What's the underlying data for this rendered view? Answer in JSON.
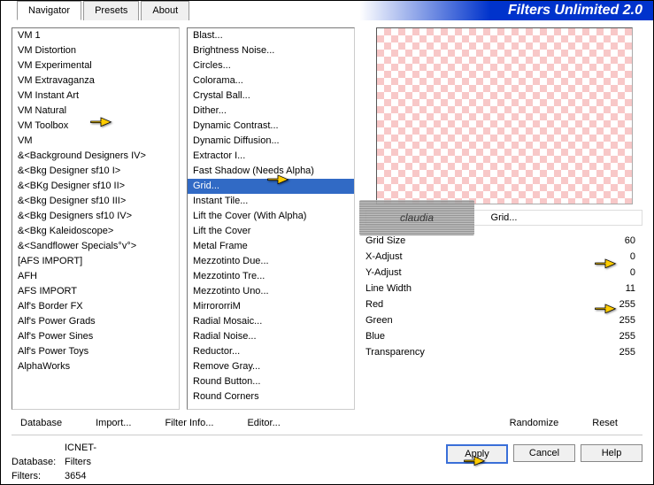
{
  "app_title": "Filters Unlimited 2.0",
  "tabs": {
    "navigator": "Navigator",
    "presets": "Presets",
    "about": "About"
  },
  "left_list": [
    "VM 1",
    "VM Distortion",
    "VM Experimental",
    "VM Extravaganza",
    "VM Instant Art",
    "VM Natural",
    "VM Toolbox",
    "VM",
    "&<Background Designers IV>",
    "&<Bkg Designer sf10 I>",
    "&<BKg Designer sf10 II>",
    "&<Bkg Designer sf10 III>",
    "&<Bkg Designers sf10 IV>",
    "&<Bkg Kaleidoscope>",
    "&<Sandflower Specials°v°>",
    "[AFS IMPORT]",
    "AFH",
    "AFS IMPORT",
    "Alf's Border FX",
    "Alf's Power Grads",
    "Alf's Power Sines",
    "Alf's Power Toys",
    "AlphaWorks"
  ],
  "mid_list": [
    "Blast...",
    "Brightness Noise...",
    "Circles...",
    "Colorama...",
    "Crystal Ball...",
    "Dither...",
    "Dynamic Contrast...",
    "Dynamic Diffusion...",
    "Extractor I...",
    "Fast Shadow (Needs Alpha)",
    "Grid...",
    "Instant Tile...",
    "Lift the Cover (With Alpha)",
    "Lift the Cover",
    "Metal Frame",
    "Mezzotinto Due...",
    "Mezzotinto Tre...",
    "Mezzotinto Uno...",
    "MirrororriM",
    "Radial Mosaic...",
    "Radial Noise...",
    "Reductor...",
    "Remove Gray...",
    "Round Button...",
    "Round Corners"
  ],
  "mid_selected_index": 10,
  "current_filter": "Grid...",
  "params": [
    {
      "label": "Grid Size",
      "value": 60
    },
    {
      "label": "X-Adjust",
      "value": 0
    },
    {
      "label": "Y-Adjust",
      "value": 0
    },
    {
      "label": "Line Width",
      "value": 11
    },
    {
      "label": "Red",
      "value": 255
    },
    {
      "label": "Green",
      "value": 255
    },
    {
      "label": "Blue",
      "value": 255
    },
    {
      "label": "Transparency",
      "value": 255
    }
  ],
  "buttons": {
    "database": "Database",
    "import": "Import...",
    "filter_info": "Filter Info...",
    "editor": "Editor...",
    "randomize": "Randomize",
    "reset": "Reset",
    "apply": "Apply",
    "cancel": "Cancel",
    "help": "Help"
  },
  "footer": {
    "db_label": "Database:",
    "db_value": "ICNET-Filters",
    "filters_label": "Filters:",
    "filters_value": "3654"
  },
  "watermark": "claudia"
}
